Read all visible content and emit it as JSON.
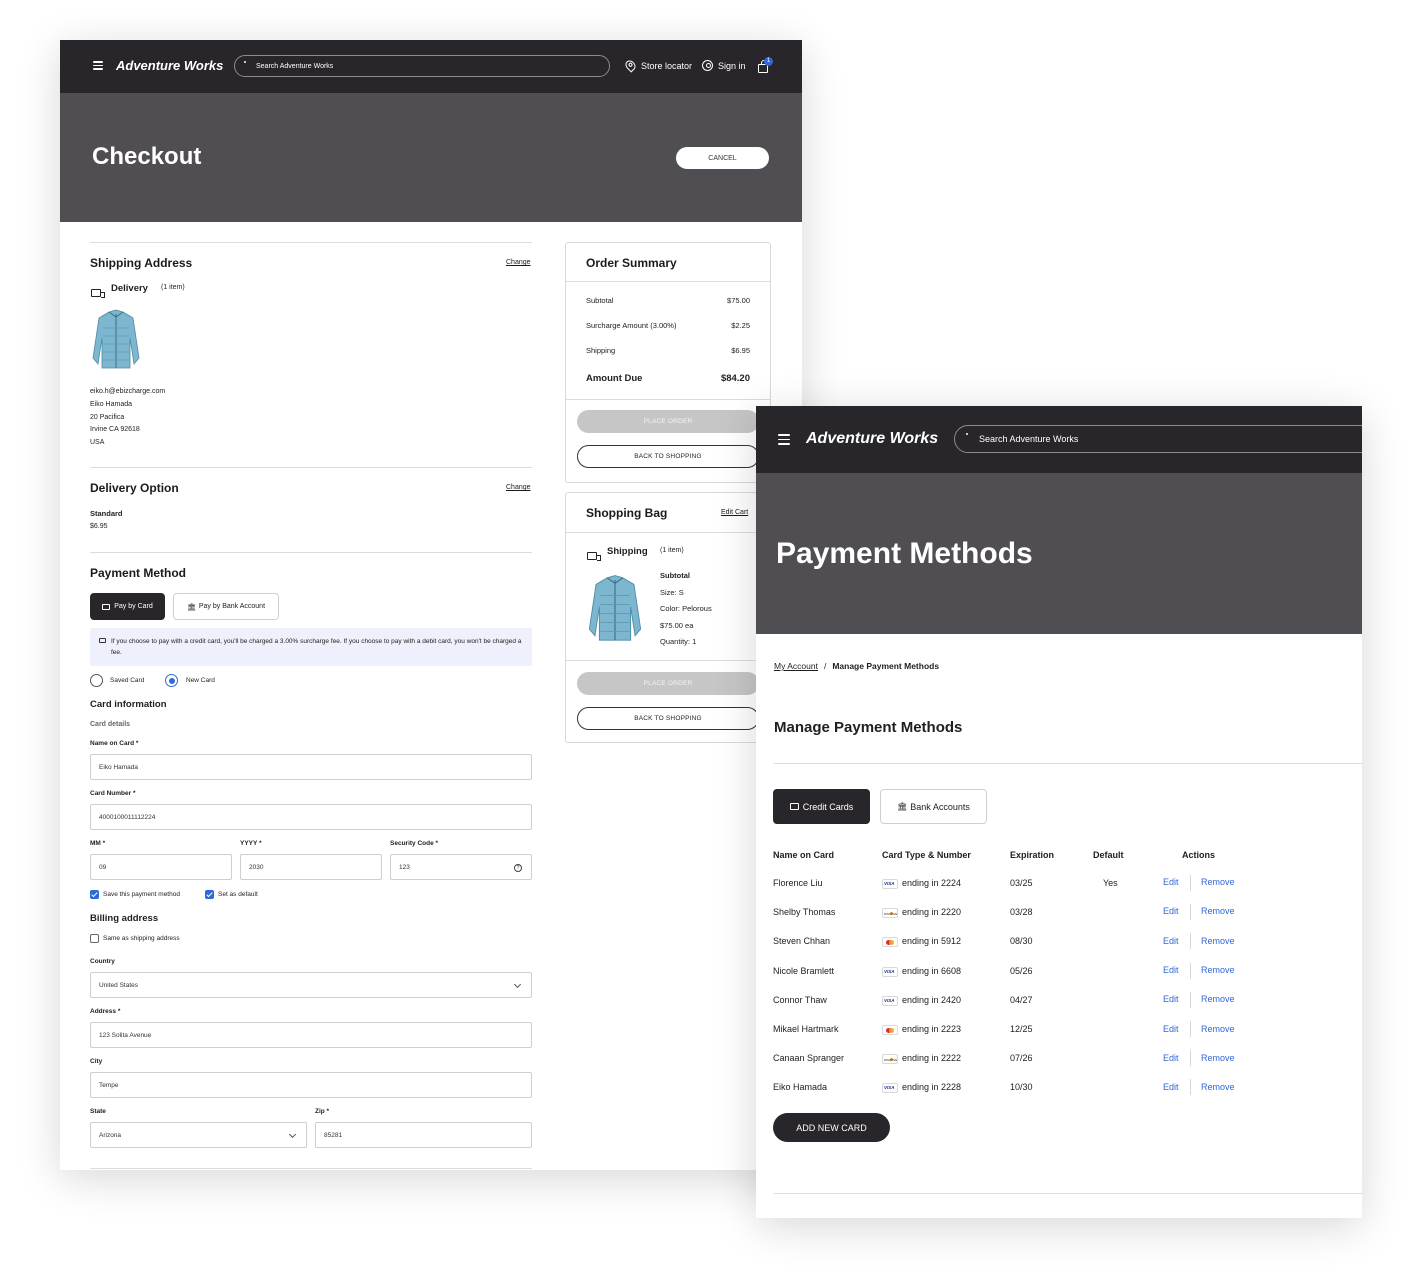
{
  "checkout": {
    "header": {
      "logo": "Adventure Works",
      "search_placeholder": "Search Adventure Works",
      "store_locator": "Store locator",
      "sign_in": "Sign in",
      "cart_count": "1"
    },
    "page_title": "Checkout",
    "cancel_label": "CANCEL",
    "shipping_address": {
      "title": "Shipping Address",
      "change": "Change",
      "delivery_label": "Delivery",
      "delivery_count": "(1 item)",
      "lines": [
        "eiko.h@ebizcharge.com",
        "Eiko Hamada",
        "20 Pacifica",
        "Irvine CA 92618",
        "USA"
      ]
    },
    "delivery_option": {
      "title": "Delivery Option",
      "change": "Change",
      "method": "Standard",
      "price": "$6.95"
    },
    "payment_method": {
      "title": "Payment Method",
      "pay_by_card": "Pay by Card",
      "pay_by_bank": "Pay by Bank Account",
      "notice": "If you choose to pay with a credit card, you'll be charged a 3.00% surcharge fee. If you choose to pay with a debit card, you won't be charged a fee.",
      "saved_card": "Saved Card",
      "new_card": "New Card",
      "card_information": "Card information",
      "card_details": "Card details",
      "name_on_card_label": "Name on Card *",
      "name_on_card_value": "Eiko Hamada",
      "card_number_label": "Card Number *",
      "card_number_value": "4000100011112224",
      "mm_label": "MM *",
      "mm_value": "09",
      "yyyy_label": "YYYY *",
      "yyyy_value": "2030",
      "security_label": "Security Code *",
      "security_value": "123",
      "save_payment": "Save this payment method",
      "set_default": "Set as default"
    },
    "billing": {
      "title": "Billing address",
      "same_as_shipping": "Same as shipping address",
      "country_label": "Country",
      "country_value": "United States",
      "address_label": "Address *",
      "address_value": "123 Solita Avenue",
      "city_label": "City",
      "city_value": "Tempe",
      "state_label": "State",
      "state_value": "Arizona",
      "zip_label": "Zip *",
      "zip_value": "85281"
    },
    "order_summary": {
      "title": "Order Summary",
      "rows": [
        {
          "label": "Subtotal",
          "value": "$75.00"
        },
        {
          "label": "Surcharge Amount (3.00%)",
          "value": "$2.25"
        },
        {
          "label": "Shipping",
          "value": "$6.95"
        }
      ],
      "amount_due_label": "Amount Due",
      "amount_due_value": "$84.20",
      "place_order": "PLACE ORDER",
      "back_to_shopping": "BACK TO SHOPPING"
    },
    "shopping_bag": {
      "title": "Shopping Bag",
      "edit_cart": "Edit Cart",
      "shipping_label": "Shipping",
      "shipping_count": "(1 item)",
      "item_title": "Subtotal",
      "item_size": "Size: S",
      "item_color": "Color: Pelorous",
      "item_price": "$75.00 ea",
      "item_qty": "Quantity: 1",
      "place_order": "PLACE ORDER",
      "back_to_shopping": "BACK TO SHOPPING"
    }
  },
  "payment_methods": {
    "header": {
      "logo": "Adventure Works",
      "search_placeholder": "Search Adventure Works"
    },
    "page_title": "Payment Methods",
    "breadcrumb": {
      "parent": "My Account",
      "separator": "/",
      "current": "Manage Payment Methods"
    },
    "section_title": "Manage Payment Methods",
    "tabs": {
      "credit_cards": "Credit Cards",
      "bank_accounts": "Bank Accounts"
    },
    "columns": [
      "Name on Card",
      "Card Type & Number",
      "Expiration",
      "Default",
      "Actions"
    ],
    "rows": [
      {
        "name": "Florence Liu",
        "brand": "visa",
        "number": "ending in 2224",
        "exp": "03/25",
        "default": "Yes"
      },
      {
        "name": "Shelby Thomas",
        "brand": "discover",
        "number": "ending in 2220",
        "exp": "03/28",
        "default": ""
      },
      {
        "name": "Steven Chhan",
        "brand": "mastercard",
        "number": "ending in 5912",
        "exp": "08/30",
        "default": ""
      },
      {
        "name": "Nicole Bramlett",
        "brand": "visa",
        "number": "ending in 6608",
        "exp": "05/26",
        "default": ""
      },
      {
        "name": "Connor Thaw",
        "brand": "visa",
        "number": "ending in 2420",
        "exp": "04/27",
        "default": ""
      },
      {
        "name": "Mikael Hartmark",
        "brand": "mastercard",
        "number": "ending in 2223",
        "exp": "12/25",
        "default": ""
      },
      {
        "name": "Canaan Spranger",
        "brand": "discover",
        "number": "ending in 2222",
        "exp": "07/26",
        "default": ""
      },
      {
        "name": "Eiko Hamada",
        "brand": "visa",
        "number": "ending in 2228",
        "exp": "10/30",
        "default": ""
      }
    ],
    "edit_label": "Edit",
    "remove_label": "Remove",
    "add_new_card": "ADD NEW CARD"
  },
  "colors": {
    "nav_bg": "#28262b",
    "hero_bg": "#514e53",
    "accent_blue": "#2f67d4",
    "disabled_button": "#c6c6c6"
  }
}
